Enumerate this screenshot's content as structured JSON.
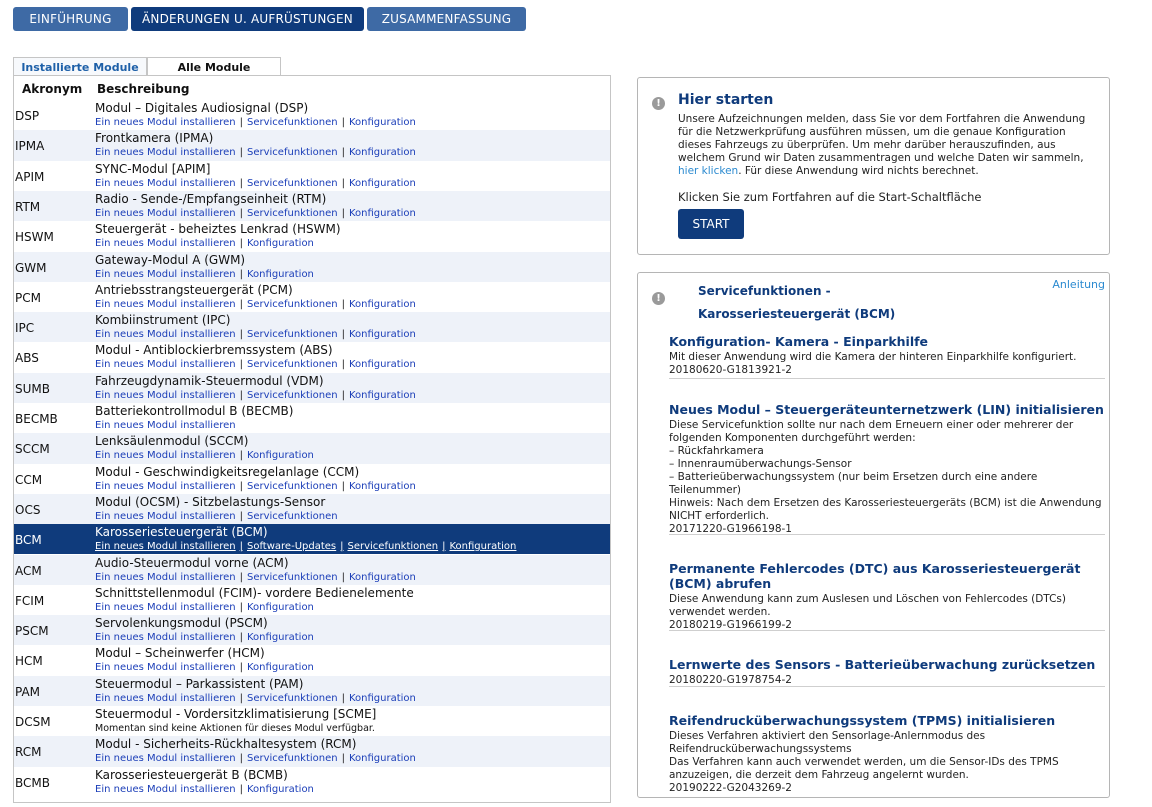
{
  "topnav": {
    "intro": "EINFÜHRUNG",
    "changes": "ÄNDERUNGEN U. AUFRÜSTUNGEN",
    "summary": "ZUSAMMENFASSUNG"
  },
  "tabs": {
    "installed": "Installierte Module",
    "all": "Alle Module"
  },
  "table": {
    "col_acronym": "Akronym",
    "col_description": "Beschreibung",
    "rows": [
      {
        "acr": "DSP",
        "desc": "Modul – Digitales Audiosignal (DSP)",
        "links": [
          "Ein neues Modul installieren",
          "Servicefunktionen",
          "Konfiguration"
        ]
      },
      {
        "acr": "IPMA",
        "desc": "Frontkamera (IPMA)",
        "links": [
          "Ein neues Modul installieren",
          "Servicefunktionen",
          "Konfiguration"
        ]
      },
      {
        "acr": "APIM",
        "desc": "SYNC-Modul [APIM]",
        "links": [
          "Ein neues Modul installieren",
          "Servicefunktionen",
          "Konfiguration"
        ]
      },
      {
        "acr": "RTM",
        "desc": "Radio - Sende-/Empfangseinheit (RTM)",
        "links": [
          "Ein neues Modul installieren",
          "Servicefunktionen",
          "Konfiguration"
        ]
      },
      {
        "acr": "HSWM",
        "desc": "Steuergerät - beheiztes Lenkrad (HSWM)",
        "links": [
          "Ein neues Modul installieren",
          "Konfiguration"
        ]
      },
      {
        "acr": "GWM",
        "desc": "Gateway-Modul A (GWM)",
        "links": [
          "Ein neues Modul installieren",
          "Konfiguration"
        ]
      },
      {
        "acr": "PCM",
        "desc": "Antriebsstrangsteuergerät (PCM)",
        "links": [
          "Ein neues Modul installieren",
          "Servicefunktionen",
          "Konfiguration"
        ]
      },
      {
        "acr": "IPC",
        "desc": "Kombiinstrument (IPC)",
        "links": [
          "Ein neues Modul installieren",
          "Servicefunktionen",
          "Konfiguration"
        ]
      },
      {
        "acr": "ABS",
        "desc": "Modul - Antiblockierbremssystem (ABS)",
        "links": [
          "Ein neues Modul installieren",
          "Servicefunktionen",
          "Konfiguration"
        ]
      },
      {
        "acr": "SUMB",
        "desc": "Fahrzeugdynamik-Steuermodul (VDM)",
        "links": [
          "Ein neues Modul installieren",
          "Servicefunktionen",
          "Konfiguration"
        ]
      },
      {
        "acr": "BECMB",
        "desc": "Batteriekontrollmodul B (BECMB)",
        "links": [
          "Ein neues Modul installieren"
        ]
      },
      {
        "acr": "SCCM",
        "desc": "Lenksäulenmodul (SCCM)",
        "links": [
          "Ein neues Modul installieren",
          "Konfiguration"
        ]
      },
      {
        "acr": "CCM",
        "desc": "Modul - Geschwindigkeitsregelanlage (CCM)",
        "links": [
          "Ein neues Modul installieren",
          "Servicefunktionen",
          "Konfiguration"
        ]
      },
      {
        "acr": "OCS",
        "desc": "Modul (OCSM) - Sitzbelastungs-Sensor",
        "links": [
          "Ein neues Modul installieren",
          "Servicefunktionen"
        ]
      },
      {
        "acr": "BCM",
        "desc": "Karosseriesteuergerät (BCM)",
        "links": [
          "Ein neues Modul installieren",
          "Software-Updates",
          "Servicefunktionen",
          "Konfiguration"
        ],
        "selected": true
      },
      {
        "acr": "ACM",
        "desc": "Audio-Steuermodul vorne (ACM)",
        "links": [
          "Ein neues Modul installieren",
          "Servicefunktionen",
          "Konfiguration"
        ]
      },
      {
        "acr": "FCIM",
        "desc": "Schnittstellenmodul (FCIM)- vordere Bedienelemente",
        "links": [
          "Ein neues Modul installieren",
          "Konfiguration"
        ]
      },
      {
        "acr": "PSCM",
        "desc": "Servolenkungsmodul (PSCM)",
        "links": [
          "Ein neues Modul installieren",
          "Konfiguration"
        ]
      },
      {
        "acr": "HCM",
        "desc": "Modul – Scheinwerfer (HCM)",
        "links": [
          "Ein neues Modul installieren",
          "Konfiguration"
        ]
      },
      {
        "acr": "PAM",
        "desc": "Steuermodul – Parkassistent (PAM)",
        "links": [
          "Ein neues Modul installieren",
          "Servicefunktionen",
          "Konfiguration"
        ]
      },
      {
        "acr": "DCSM",
        "desc": "Steuermodul - Vordersitzklimatisierung [SCME]",
        "links": [],
        "note": "Momentan sind keine Aktionen für dieses Modul verfügbar."
      },
      {
        "acr": "RCM",
        "desc": "Modul - Sicherheits-Rückhaltesystem (RCM)",
        "links": [
          "Ein neues Modul installieren",
          "Servicefunktionen",
          "Konfiguration"
        ]
      },
      {
        "acr": "BCMB",
        "desc": "Karosseriesteuergerät B (BCMB)",
        "links": [
          "Ein neues Modul installieren",
          "Konfiguration"
        ]
      }
    ]
  },
  "start": {
    "title": "Hier starten",
    "body_before": "Unsere Aufzeichnungen melden, dass Sie vor dem Fortfahren die Anwendung für die Netzwerkprüfung ausführen müssen, um die genaue Konfiguration dieses Fahrzeugs zu überprüfen. Um mehr darüber herauszufinden, aus welchem Grund wir Daten zusammentragen und welche Daten wir sammeln, ",
    "link": "hier klicken",
    "body_after": ". Für diese Anwendung wird nichts berechnet.",
    "click_line": "Klicken Sie zum Fortfahren auf die Start-Schaltfläche",
    "button": "START"
  },
  "service": {
    "title_line1": "Servicefunktionen -",
    "title_line2": "Karosseriesteuergerät (BCM)",
    "anleitung": "Anleitung",
    "items": [
      {
        "title": "Konfiguration- Kamera - Einparkhilfe",
        "body": "Mit dieser Anwendung wird die Kamera der hinteren Einparkhilfe konfiguriert.",
        "id": "20180620-G1813921-2"
      },
      {
        "title": "Neues Modul – Steuergeräteunternetzwerk (LIN) initialisieren",
        "body": "Diese Servicefunktion sollte nur nach dem Erneuern einer oder mehrerer der folgenden Komponenten durchgeführt werden:\n– Rückfahrkamera\n– Innenraumüberwachungs-Sensor\n– Batterieüberwachungssystem (nur beim Ersetzen durch eine andere Teilenummer)\nHinweis: Nach dem Ersetzen des Karosseriesteuergeräts (BCM) ist die Anwendung NICHT erforderlich.",
        "id": "20171220-G1966198-1"
      },
      {
        "title": "Permanente Fehlercodes (DTC) aus Karosseriesteuergerät (BCM) abrufen",
        "body": "Diese Anwendung kann zum Auslesen und Löschen von Fehlercodes (DTCs) verwendet werden.",
        "id": "20180219-G1966199-2"
      },
      {
        "title": "Lernwerte des Sensors - Batterieüberwachung zurücksetzen",
        "body": "",
        "id": "20180220-G1978754-2"
      },
      {
        "title": "Reifendrucküberwachungssystem (TPMS) initialisieren",
        "body": "Dieses Verfahren aktiviert den Sensorlage-Anlernmodus des Reifendrucküberwachungssystems\nDas Verfahren kann auch verwendet werden, um die Sensor-IDs des TPMS anzuzeigen, die derzeit dem Fahrzeug angelernt wurden.",
        "id": "20190222-G2043269-2"
      }
    ]
  }
}
